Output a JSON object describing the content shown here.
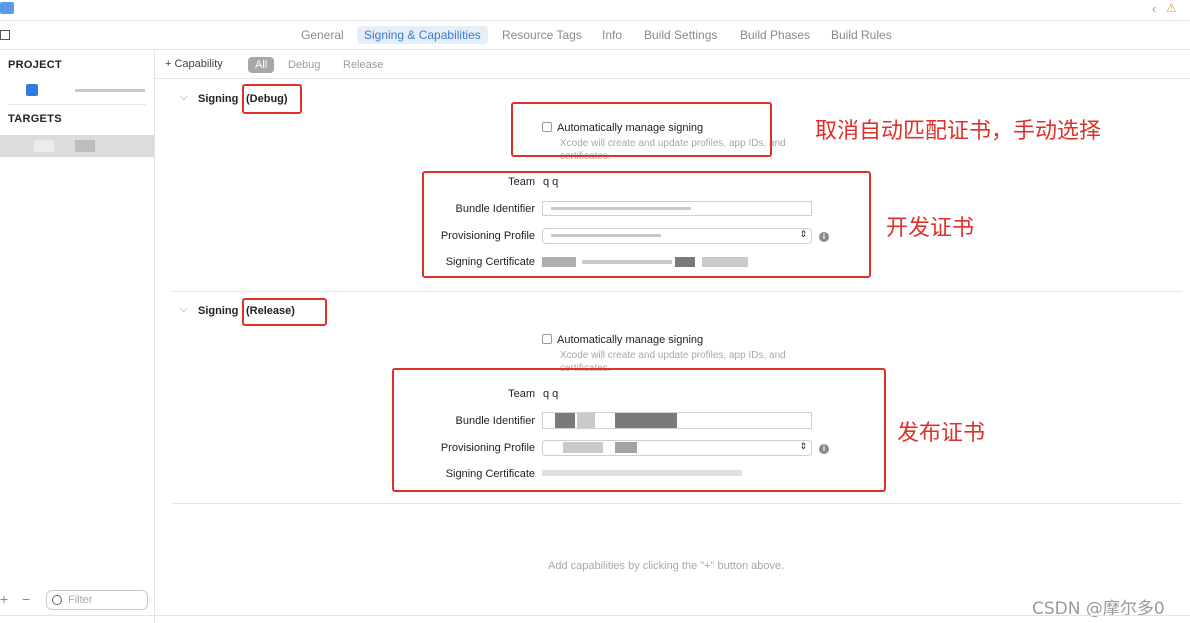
{
  "tabs": [
    "General",
    "Signing & Capabilities",
    "Resource Tags",
    "Info",
    "Build Settings",
    "Build Phases",
    "Build Rules"
  ],
  "active_tab": "Signing & Capabilities",
  "sidebar": {
    "project_title": "PROJECT",
    "targets_title": "TARGETS",
    "filter_placeholder": "Filter"
  },
  "capability_bar": {
    "add_label": "+ Capability",
    "subtabs": [
      "All",
      "Debug",
      "Release"
    ]
  },
  "debug": {
    "section_title": "Signing",
    "config_label": "(Debug)",
    "auto_label": "Automatically manage signing",
    "auto_help": "Xcode will create and update profiles, app IDs, and",
    "auto_help2": "certificates.",
    "team_label": "Team",
    "team_value": "q q",
    "bundle_label": "Bundle Identifier",
    "profile_label": "Provisioning Profile",
    "cert_label": "Signing Certificate"
  },
  "release": {
    "section_title": "Signing",
    "config_label": "(Release)",
    "auto_label": "Automatically manage signing",
    "auto_help": "Xcode will create and update profiles, app IDs, and",
    "auto_help2": "certificates.",
    "team_label": "Team",
    "team_value": "q q",
    "bundle_label": "Bundle Identifier",
    "profile_label": "Provisioning Profile",
    "cert_label": "Signing Certificate"
  },
  "footer_hint": "Add capabilities by clicking the \"+\" button above.",
  "annotations": {
    "manual": "取消自动匹配证书，手动选择",
    "dev_cert": "开发证书",
    "dist_cert": "发布证书"
  },
  "watermark": "CSDN @摩尔多0",
  "colors": {
    "accent": "#3a7bd5",
    "annotation_red": "#e0302a"
  }
}
